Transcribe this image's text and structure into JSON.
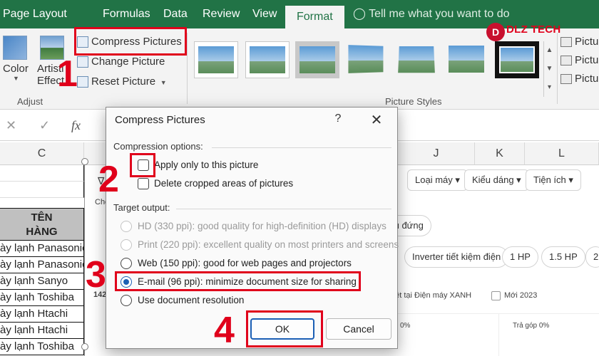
{
  "ribbon_tabs": [
    "Page Layout",
    "Formulas",
    "Data",
    "Review",
    "View",
    "Format"
  ],
  "tell_me": "Tell me what you want to do",
  "adjust": {
    "color_label": "Color",
    "artistic_label_1": "Artisti",
    "artistic_label_2": "Effect",
    "compress": "Compress Pictures",
    "change": "Change Picture",
    "reset": "Reset Picture",
    "group_label": "Adjust"
  },
  "picture_styles_label": "Picture Styles",
  "right_cmds": [
    "Pictu",
    "Pictu",
    "Pictu"
  ],
  "logo_text": "DLZ TECH",
  "formula_bar": {
    "cancel": "✕",
    "enter": "✓",
    "fx": "fx"
  },
  "sheet": {
    "col_c": "C",
    "col_j": "J",
    "col_k": "K",
    "col_l": "L",
    "header_line1": "TÊN",
    "header_line2": "HÀNG",
    "rows": [
      "ày lạnh Panasonic",
      "ày lạnh Panasonic",
      "ày lạnh Sanyo",
      "ày lạnh Toshiba",
      "ày lạnh Htachi",
      "ày lạnh Htachi",
      "ày lạnh Toshiba",
      "ày lạnh"
    ]
  },
  "web": {
    "filters": [
      "Loại máy ▾",
      "Kiểu dáng ▾",
      "Tiện ích ▾"
    ],
    "chip_tu_dung": "tủ đứng",
    "chips2": [
      "Inverter tiết kiệm điện",
      "1 HP",
      "1.5 HP",
      "2"
    ],
    "checks_text1": "c biệt tại Điện máy XANH",
    "checks_text2": "Mới 2023",
    "left_small_1": "Chọ",
    "left_small_2": "142",
    "pct1": "0%",
    "pct2": "Trả góp 0%",
    "filter_icon": "∇"
  },
  "dialog": {
    "title": "Compress Pictures",
    "help": "?",
    "close": "✕",
    "compression_options": "Compression options:",
    "apply_only": "Apply only to this picture",
    "delete_cropped": "Delete cropped areas of pictures",
    "target_output": "Target output:",
    "options": [
      {
        "label": "HD (330 ppi): good quality for high-definition (HD) displays",
        "disabled": true
      },
      {
        "label": "Print (220 ppi): excellent quality on most printers and screens",
        "disabled": true
      },
      {
        "label": "Web (150 ppi): good for web pages and projectors",
        "disabled": false
      },
      {
        "label": "E-mail (96 ppi): minimize document size for sharing",
        "disabled": false,
        "selected": true
      },
      {
        "label": "Use document resolution",
        "disabled": false
      }
    ],
    "ok": "OK",
    "cancel": "Cancel"
  },
  "annotations": [
    "1",
    "2",
    "3",
    "4"
  ],
  "colors": {
    "ribbon_green": "#217346",
    "annotation_red": "#e0001b",
    "selected_blue": "#1b5fb5"
  }
}
